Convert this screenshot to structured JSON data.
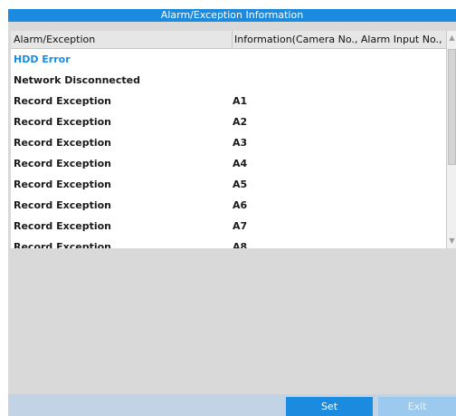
{
  "dialog": {
    "title": "Alarm/Exception Information"
  },
  "table": {
    "columns": [
      "Alarm/Exception",
      "Information(Camera No., Alarm Input No., ..."
    ],
    "rows": [
      {
        "type": "HDD Error",
        "info": "",
        "selected": true
      },
      {
        "type": "Network Disconnected",
        "info": ""
      },
      {
        "type": "Record Exception",
        "info": "A1"
      },
      {
        "type": "Record Exception",
        "info": "A2"
      },
      {
        "type": "Record Exception",
        "info": "A3"
      },
      {
        "type": "Record Exception",
        "info": "A4"
      },
      {
        "type": "Record Exception",
        "info": "A5"
      },
      {
        "type": "Record Exception",
        "info": "A6"
      },
      {
        "type": "Record Exception",
        "info": "A7"
      },
      {
        "type": "Record Exception",
        "info": "A8"
      }
    ]
  },
  "footer": {
    "set_label": "Set",
    "exit_label": "Exit"
  },
  "colors": {
    "accent": "#1b8be0",
    "footer_bg": "#c3d3e6",
    "disabled_button": "#9cc9ee"
  }
}
